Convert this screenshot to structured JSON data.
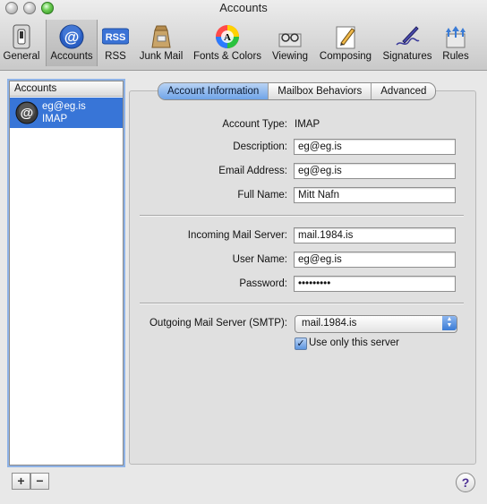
{
  "window": {
    "title": "Accounts"
  },
  "toolbar": {
    "items": [
      {
        "label": "General",
        "icon": "general-switch-icon"
      },
      {
        "label": "Accounts",
        "icon": "at-sign-icon"
      },
      {
        "label": "RSS",
        "icon": "rss-icon"
      },
      {
        "label": "Junk Mail",
        "icon": "junk-mail-bag-icon"
      },
      {
        "label": "Fonts & Colors",
        "icon": "fonts-colors-icon"
      },
      {
        "label": "Viewing",
        "icon": "viewing-glasses-icon"
      },
      {
        "label": "Composing",
        "icon": "composing-pencil-icon"
      },
      {
        "label": "Signatures",
        "icon": "signature-pen-icon"
      },
      {
        "label": "Rules",
        "icon": "rules-arrows-icon"
      }
    ],
    "selected": "Accounts",
    "rss_badge": "RSS"
  },
  "sidebar": {
    "header": "Accounts",
    "accounts": [
      {
        "name": "eg@eg.is",
        "type": "IMAP"
      }
    ],
    "add_label": "+",
    "remove_label": "−"
  },
  "tabs": [
    {
      "label": "Account Information",
      "active": true
    },
    {
      "label": "Mailbox Behaviors",
      "active": false
    },
    {
      "label": "Advanced",
      "active": false
    }
  ],
  "form": {
    "account_type_label": "Account Type:",
    "account_type_value": "IMAP",
    "description_label": "Description:",
    "description_value": "eg@eg.is",
    "email_label": "Email Address:",
    "email_value": "eg@eg.is",
    "full_name_label": "Full Name:",
    "full_name_value": "Mitt Nafn",
    "incoming_label": "Incoming Mail Server:",
    "incoming_value": "mail.1984.is",
    "username_label": "User Name:",
    "username_value": "eg@eg.is",
    "password_label": "Password:",
    "password_value": "•••••••••",
    "smtp_label": "Outgoing Mail Server (SMTP):",
    "smtp_value": "mail.1984.is",
    "use_only_label": "Use only this server",
    "use_only_checked": true
  },
  "help": {
    "label": "?"
  },
  "colors": {
    "accent": "#3875d7",
    "tab_active": "#6fa4e8"
  }
}
